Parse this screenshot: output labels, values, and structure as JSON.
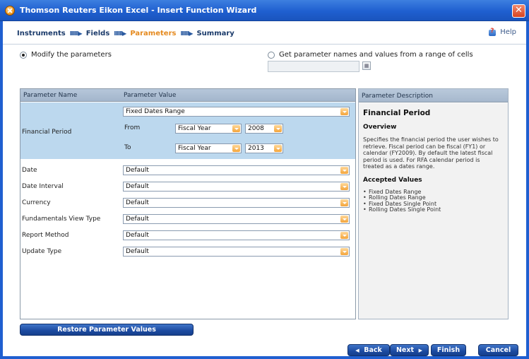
{
  "window": {
    "title": "Thomson Reuters Eikon Excel - Insert Function Wizard",
    "close_glyph": "✕"
  },
  "nav": {
    "steps": [
      "Instruments",
      "Fields",
      "Parameters",
      "Summary"
    ],
    "active_step": "Parameters",
    "separator": "IIIIII▶",
    "help_label": "Help"
  },
  "options": {
    "modify_label": "Modify the parameters",
    "range_label": "Get parameter names and values from a range of cells",
    "selected": "modify"
  },
  "param_table": {
    "header_name": "Parameter Name",
    "header_value": "Parameter Value",
    "financial_period": {
      "name": "Financial Period",
      "mode": "Fixed Dates Range",
      "from_label": "From",
      "from_period": "Fiscal Year",
      "from_year": "2008",
      "to_label": "To",
      "to_period": "Fiscal Year",
      "to_year": "2013"
    },
    "rows": [
      {
        "name": "Date",
        "value": "Default"
      },
      {
        "name": "Date Interval",
        "value": "Default"
      },
      {
        "name": "Currency",
        "value": "Default"
      },
      {
        "name": "Fundamentals View Type",
        "value": "Default"
      },
      {
        "name": "Report Method",
        "value": "Default"
      },
      {
        "name": "Update Type",
        "value": "Default"
      }
    ]
  },
  "description": {
    "header": "Parameter Description",
    "title": "Financial Period",
    "overview_heading": "Overview",
    "overview_text": "Specifies the financial period the user wishes to retrieve. Fiscal period can be fiscal (FY1) or calendar (FY2009). By default the latest fiscal period is used. For RFA calendar period is treated as a dates range.",
    "accepted_heading": "Accepted Values",
    "accepted_values": [
      "Fixed Dates Range",
      "Rolling Dates Range",
      "Fixed Dates Single Point",
      "Rolling Dates Single Point"
    ]
  },
  "buttons": {
    "restore": "Restore Parameter Values",
    "back": "Back",
    "next": "Next",
    "finish": "Finish",
    "cancel": "Cancel"
  }
}
